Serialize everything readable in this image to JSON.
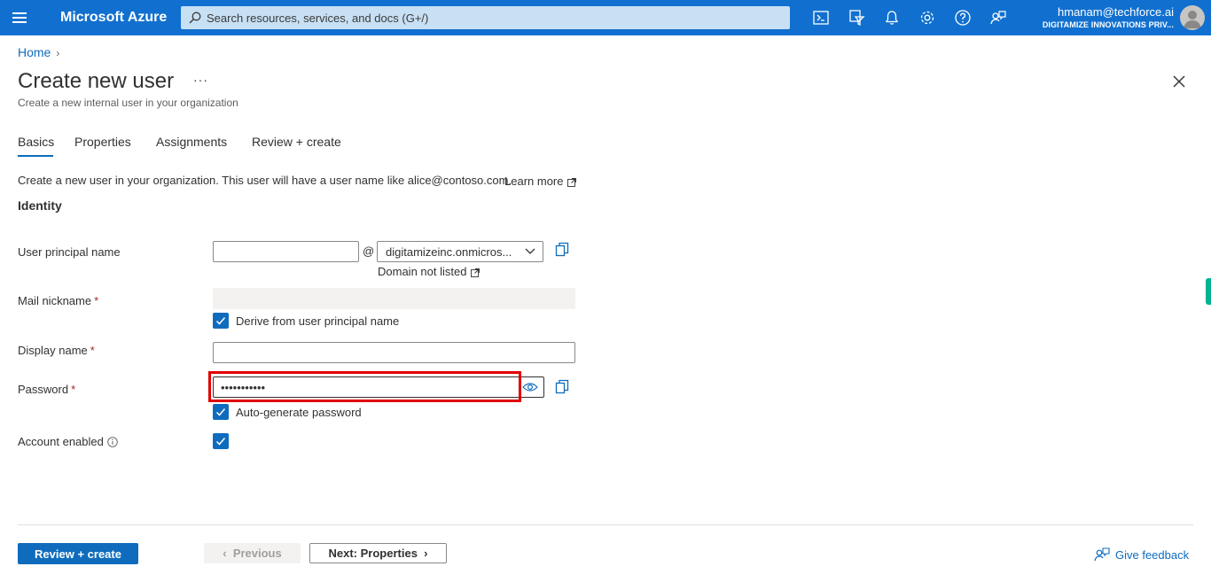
{
  "topbar": {
    "brand": "Microsoft Azure",
    "search_placeholder": "Search resources, services, and docs (G+/)",
    "icons": [
      "cloud-shell-icon",
      "directory-filter-icon",
      "notifications-icon",
      "settings-icon",
      "help-icon",
      "feedback-icon"
    ],
    "account": {
      "username": "hmanam@techforce.ai",
      "organization": "DIGITAMIZE INNOVATIONS PRIV..."
    },
    "color": "#1170cf"
  },
  "breadcrumb": {
    "home": "Home"
  },
  "page": {
    "title": "Create new user",
    "more": "···",
    "subtitle": "Create a new internal user in your organization"
  },
  "tabs": [
    "Basics",
    "Properties",
    "Assignments",
    "Review + create"
  ],
  "active_tab": "Basics",
  "intro_text": "Create a new user in your organization. This user will have a user name like alice@contoso.com.",
  "learn_more": "Learn more",
  "section_title": "Identity",
  "form": {
    "upn_label": "User principal name",
    "upn_value": "",
    "at_symbol": "@",
    "domain_value": "digitamizeinc.onmicros...",
    "domain_not_listed": "Domain not listed",
    "mail_nickname_label": "Mail nickname",
    "mail_nickname_value": "",
    "derive_label": "Derive from user principal name",
    "derive_checked": true,
    "display_name_label": "Display name",
    "display_name_value": "",
    "password_label": "Password",
    "password_value": "•••••••••••",
    "autogen_label": "Auto-generate password",
    "autogen_checked": true,
    "account_enabled_label": "Account enabled",
    "account_enabled_checked": true,
    "required_mark": "*"
  },
  "footer": {
    "review_create": "Review + create",
    "previous": "Previous",
    "next": "Next: Properties",
    "give_feedback": "Give feedback"
  },
  "colors": {
    "accent": "#0f6cbd",
    "highlight": "#e00000",
    "required": "#a4262c"
  }
}
